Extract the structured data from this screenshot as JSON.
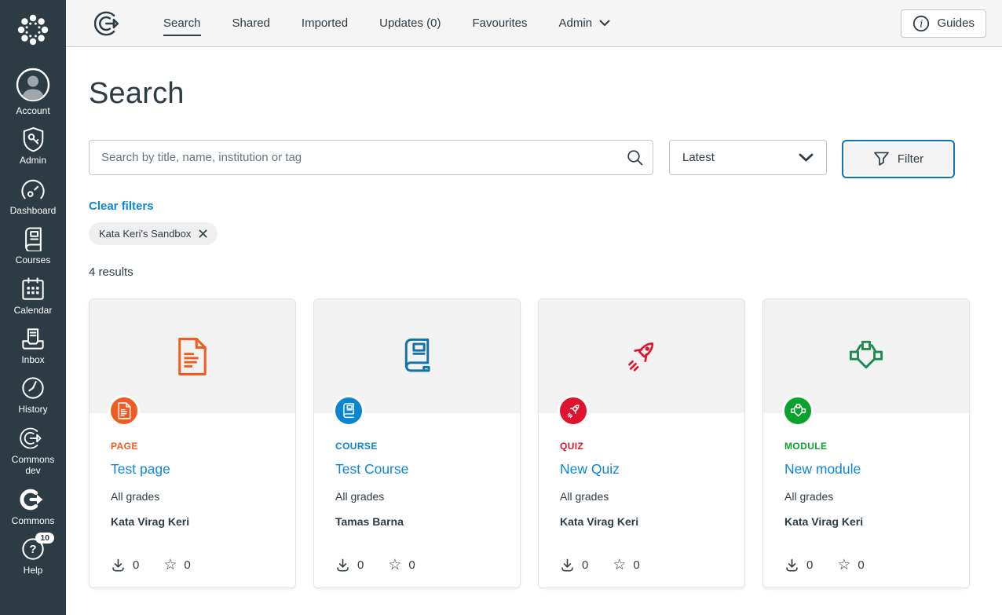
{
  "sidebar": {
    "items": [
      {
        "label": "Account"
      },
      {
        "label": "Admin"
      },
      {
        "label": "Dashboard"
      },
      {
        "label": "Courses"
      },
      {
        "label": "Calendar"
      },
      {
        "label": "Inbox"
      },
      {
        "label": "History"
      },
      {
        "label": "Commons dev"
      },
      {
        "label": "Commons"
      },
      {
        "label": "Help",
        "badge": "10"
      }
    ]
  },
  "topnav": {
    "tabs": [
      {
        "label": "Search",
        "active": true
      },
      {
        "label": "Shared"
      },
      {
        "label": "Imported"
      },
      {
        "label": "Updates (0)"
      },
      {
        "label": "Favourites"
      },
      {
        "label": "Admin"
      }
    ],
    "guides_label": "Guides"
  },
  "main": {
    "title": "Search",
    "search_placeholder": "Search by title, name, institution or tag",
    "sort_value": "Latest",
    "filter_label": "Filter",
    "clear_filters_label": "Clear filters",
    "filter_chip": "Kata Keri's Sandbox",
    "results_count": "4 results"
  },
  "cards": [
    {
      "type": "PAGE",
      "title": "Test page",
      "grades": "All grades",
      "author": "Kata Virag Keri",
      "downloads": "0",
      "favourites": "0"
    },
    {
      "type": "COURSE",
      "title": "Test Course",
      "grades": "All grades",
      "author": "Tamas Barna",
      "downloads": "0",
      "favourites": "0"
    },
    {
      "type": "QUIZ",
      "title": "New Quiz",
      "grades": "All grades",
      "author": "Kata Virag Keri",
      "downloads": "0",
      "favourites": "0"
    },
    {
      "type": "MODULE",
      "title": "New module",
      "grades": "All grades",
      "author": "Kata Virag Keri",
      "downloads": "0",
      "favourites": "0"
    }
  ],
  "icons": {
    "star_outline": "☆"
  },
  "colors": {
    "sidebar_bg": "#2D3B45",
    "topbar_bg": "#F5F5F5",
    "text": "#2D3B45",
    "link_blue": "#0B87DA",
    "focus_ring_blue": "#0E74BB",
    "page_orange": "#F05B22",
    "course_blue": "#0C85D0",
    "course_hero_blue": "#1171A9",
    "quiz_red": "#E0122E",
    "module_green": "#0AA12C",
    "module_hero_green": "#1F8A52",
    "card_hero_gray": "#F2F2F2"
  }
}
